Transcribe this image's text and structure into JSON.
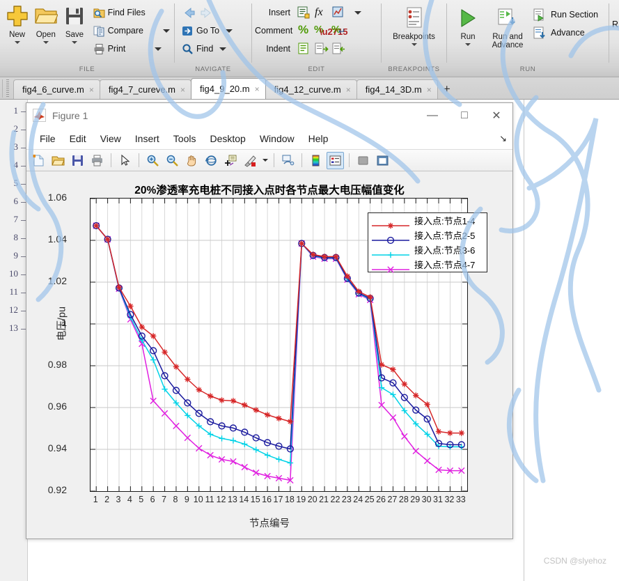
{
  "ribbon": {
    "groups": [
      {
        "title": "FILE",
        "big": [
          {
            "label": "New",
            "icon": "new-plus-icon",
            "dropdown": true
          },
          {
            "label": "Open",
            "icon": "open-folder-icon",
            "dropdown": true
          },
          {
            "label": "Save",
            "icon": "save-disk-icon",
            "dropdown": true
          }
        ],
        "small": [
          {
            "label": "Find Files",
            "icon": "find-files-icon",
            "dropdown": false
          },
          {
            "label": "Compare",
            "icon": "compare-icon",
            "dropdown": true
          },
          {
            "label": "Print",
            "icon": "print-icon",
            "dropdown": true
          }
        ]
      },
      {
        "title": "NAVIGATE",
        "small": [
          {
            "label": "",
            "icon": "back-arrow-icon",
            "dropdown": false
          },
          {
            "label": "Go To",
            "icon": "goto-icon",
            "dropdown": true
          },
          {
            "label": "Find",
            "icon": "find-magnifier-icon",
            "dropdown": true
          }
        ]
      },
      {
        "title": "EDIT",
        "rows": [
          {
            "label": "Insert",
            "icons": [
              "insert-block-icon",
              "function-fx-icon",
              "insert-plot-icon"
            ],
            "dropdown": true
          },
          {
            "label": "Comment",
            "icons": [
              "comment-percent-icon",
              "uncomment-percent-icon",
              "wrap-comment-icon"
            ],
            "dropdown": false
          },
          {
            "label": "Indent",
            "icons": [
              "indent-icon",
              "indent-right-icon",
              "indent-left-icon"
            ],
            "dropdown": false
          }
        ]
      },
      {
        "title": "BREAKPOINTS",
        "big": [
          {
            "label": "Breakpoints",
            "icon": "breakpoints-icon",
            "dropdown": true
          }
        ]
      },
      {
        "title": "RUN",
        "big": [
          {
            "label": "Run",
            "icon": "run-play-icon",
            "dropdown": true
          },
          {
            "label": "Run and Advance",
            "icon": "run-advance-icon",
            "dropdown": false
          }
        ],
        "small": [
          {
            "label": "Run Section",
            "icon": "run-section-icon",
            "dropdown": false
          },
          {
            "label": "Advance",
            "icon": "advance-icon",
            "dropdown": false
          }
        ]
      }
    ],
    "clipped_group_title": "R"
  },
  "tabs": {
    "items": [
      {
        "label": "fig4_6_curve.m",
        "active": false
      },
      {
        "label": "fig4_7_cureve.m",
        "active": false
      },
      {
        "label": "fig4_9_20.m",
        "active": true
      },
      {
        "label": "fig4_12_curve.m",
        "active": false
      },
      {
        "label": "fig4_14_3D.m",
        "active": false
      }
    ],
    "close_glyph": "×",
    "new_tab_glyph": "+"
  },
  "editor": {
    "line_numbers": [
      "1",
      "2",
      "3",
      "4",
      "5",
      "6",
      "7",
      "8",
      "9",
      "10",
      "11",
      "12",
      "13"
    ]
  },
  "figure_window": {
    "title": "Figure 1",
    "app_icon": "matlab-logo-icon",
    "window_buttons": {
      "minimize": "—",
      "maximize": "□",
      "close": "✕"
    },
    "menu": [
      "File",
      "Edit",
      "View",
      "Insert",
      "Tools",
      "Desktop",
      "Window",
      "Help"
    ],
    "dock_glyph": "↘",
    "toolbar": [
      {
        "name": "new-figure-icon",
        "selected": false
      },
      {
        "name": "open-file-icon",
        "selected": false
      },
      {
        "name": "save-figure-icon",
        "selected": false
      },
      {
        "name": "print-figure-icon",
        "selected": false
      },
      {
        "name": "separator",
        "selected": false
      },
      {
        "name": "pointer-arrow-icon",
        "selected": false
      },
      {
        "name": "separator",
        "selected": false
      },
      {
        "name": "zoom-in-icon",
        "selected": false
      },
      {
        "name": "zoom-out-icon",
        "selected": false
      },
      {
        "name": "pan-hand-icon",
        "selected": false
      },
      {
        "name": "rotate-3d-icon",
        "selected": false
      },
      {
        "name": "data-cursor-icon",
        "selected": false
      },
      {
        "name": "brush-icon",
        "selected": false
      },
      {
        "name": "brush-dropdown-icon",
        "selected": false
      },
      {
        "name": "separator",
        "selected": false
      },
      {
        "name": "link-plot-icon",
        "selected": false
      },
      {
        "name": "separator",
        "selected": false
      },
      {
        "name": "colorbar-icon",
        "selected": false
      },
      {
        "name": "legend-icon",
        "selected": true
      },
      {
        "name": "separator",
        "selected": false
      },
      {
        "name": "hide-plot-tools-icon",
        "selected": false
      },
      {
        "name": "show-plot-tools-icon",
        "selected": false
      }
    ]
  },
  "chart_data": {
    "type": "line",
    "title": "20%渗透率充电桩不同接入点时各节点最大电压幅值变化",
    "xlabel": "节点编号",
    "ylabel": "电压/pu",
    "grid": true,
    "legend_position": "north-east-inside",
    "xlim": [
      0.5,
      33.5
    ],
    "ylim": [
      0.92,
      1.06
    ],
    "yticks": [
      "1.06",
      "1.04",
      "1.02",
      "1",
      "0.98",
      "0.96",
      "0.94",
      "0.92"
    ],
    "ytick_values": [
      1.06,
      1.04,
      1.02,
      1.0,
      0.98,
      0.96,
      0.94,
      0.92
    ],
    "categories": [
      1,
      2,
      3,
      4,
      5,
      6,
      7,
      8,
      9,
      10,
      11,
      12,
      13,
      14,
      15,
      16,
      17,
      18,
      19,
      20,
      21,
      22,
      23,
      24,
      25,
      26,
      27,
      28,
      29,
      30,
      31,
      32,
      33
    ],
    "xtick_labels": [
      "1",
      "2",
      "3",
      "4",
      "5",
      "6",
      "7",
      "8",
      "9",
      "10",
      "11",
      "12",
      "13",
      "14",
      "15",
      "16",
      "17",
      "18",
      "19",
      "20",
      "21",
      "22",
      "23",
      "24",
      "25",
      "26",
      "27",
      "28",
      "29",
      "30",
      "31",
      "32",
      "33"
    ],
    "series": [
      {
        "name": "接入点:节点1-4",
        "color": "#d62728",
        "marker": "asterisk",
        "values": [
          1.047,
          1.0405,
          1.0175,
          1.0085,
          0.9985,
          0.9942,
          0.9865,
          0.9795,
          0.9735,
          0.9685,
          0.9655,
          0.9635,
          0.9632,
          0.9612,
          0.9588,
          0.9565,
          0.9548,
          0.9533,
          1.0385,
          1.0332,
          1.0322,
          1.0322,
          1.0228,
          1.0155,
          1.0128,
          0.9805,
          0.9782,
          0.9712,
          0.9658,
          0.9615,
          0.9485,
          0.9478,
          0.9478
        ]
      },
      {
        "name": "接入点:节点2-5",
        "color": "#1a1a9e",
        "marker": "circle",
        "values": [
          1.047,
          1.0405,
          1.0172,
          1.0045,
          0.9942,
          0.9872,
          0.9752,
          0.9682,
          0.9622,
          0.9572,
          0.9532,
          0.9512,
          0.9502,
          0.9482,
          0.9455,
          0.9432,
          0.9415,
          0.9402,
          1.0385,
          1.0328,
          1.0318,
          1.0318,
          1.0218,
          1.0148,
          1.0122,
          0.9742,
          0.9718,
          0.9648,
          0.9588,
          0.9545,
          0.9428,
          0.9422,
          0.9422
        ]
      },
      {
        "name": "接入点:节点3-6",
        "color": "#00d2e6",
        "marker": "plus",
        "values": [
          1.047,
          1.0405,
          1.017,
          1.0032,
          0.9922,
          0.9828,
          0.9688,
          0.9622,
          0.9562,
          0.9512,
          0.9472,
          0.9452,
          0.9442,
          0.9425,
          0.9398,
          0.9372,
          0.9352,
          0.9335,
          1.0385,
          1.0325,
          1.0315,
          1.0315,
          1.0215,
          1.0145,
          1.0118,
          0.9695,
          0.9662,
          0.9585,
          0.9522,
          0.9472,
          0.9415,
          0.9412,
          0.9412
        ]
      },
      {
        "name": "接入点:节点4-7",
        "color": "#e020e0",
        "marker": "cross",
        "values": [
          1.047,
          1.0405,
          1.0168,
          1.0022,
          0.9905,
          0.9632,
          0.9572,
          0.9512,
          0.9455,
          0.9405,
          0.9372,
          0.9352,
          0.9342,
          0.9315,
          0.9288,
          0.9272,
          0.9262,
          0.9252,
          1.0385,
          1.0322,
          1.0312,
          1.0312,
          1.0212,
          1.0142,
          1.0115,
          0.9612,
          0.9552,
          0.9462,
          0.9392,
          0.9345,
          0.9302,
          0.9298,
          0.9298
        ]
      }
    ]
  },
  "watermark": "CSDN @slyehoz"
}
